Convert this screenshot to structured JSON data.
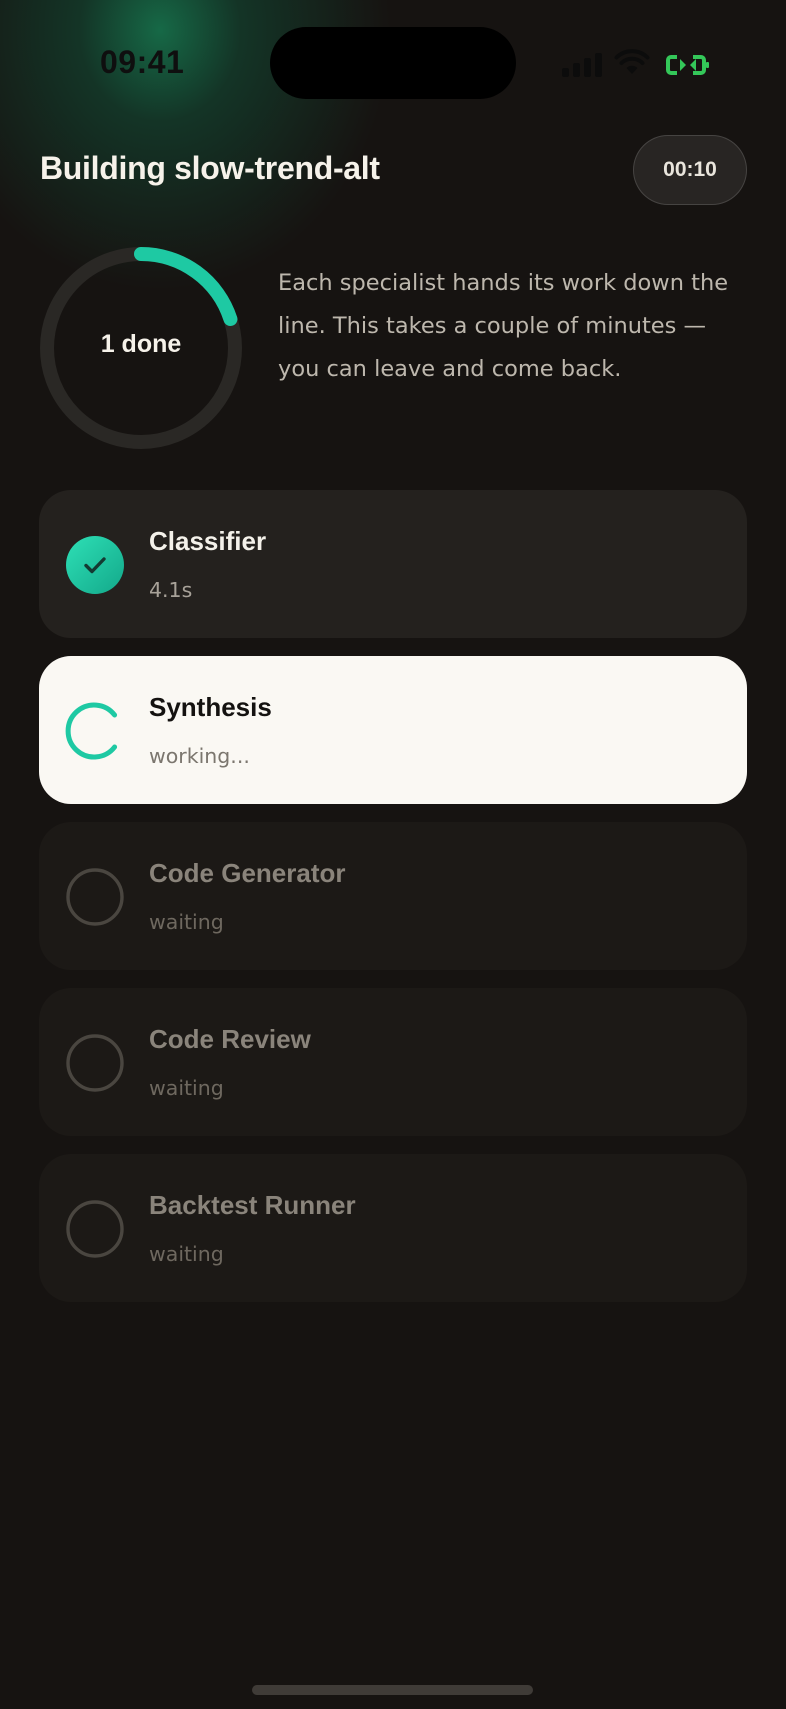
{
  "status_bar": {
    "time": "09:41"
  },
  "header": {
    "title": "Building slow-trend-alt",
    "elapsed": "00:10"
  },
  "progress": {
    "label": "1 done",
    "completed_fraction": 0.2,
    "description": "Each specialist hands its work down the line. This takes a couple of minutes — you can leave and come back."
  },
  "steps": [
    {
      "name": "Classifier",
      "status_text": "4.1s",
      "state": "done"
    },
    {
      "name": "Synthesis",
      "status_text": "working...",
      "state": "active"
    },
    {
      "name": "Code Generator",
      "status_text": "waiting",
      "state": "pending"
    },
    {
      "name": "Code Review",
      "status_text": "waiting",
      "state": "pending"
    },
    {
      "name": "Backtest Runner",
      "status_text": "waiting",
      "state": "pending"
    }
  ],
  "colors": {
    "accent": "#1ec9a3",
    "background": "#161311",
    "glow": "#167850",
    "battery": "#34c759"
  },
  "icons": [
    "check-icon",
    "spinner-icon",
    "empty-circle-icon",
    "signal-icon",
    "wifi-icon",
    "battery-icon"
  ]
}
